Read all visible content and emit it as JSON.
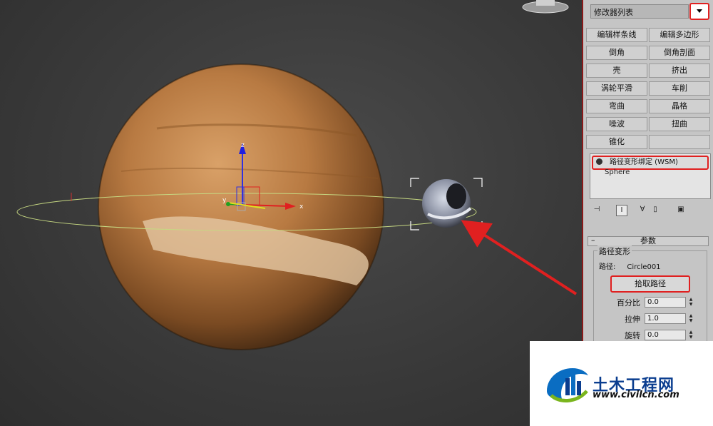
{
  "modifier_panel": {
    "list_label": "修改器列表",
    "buttons": [
      [
        "编辑样条线",
        "编辑多边形"
      ],
      [
        "倒角",
        "倒角剖面"
      ],
      [
        "壳",
        "挤出"
      ],
      [
        "涡轮平滑",
        "车削"
      ],
      [
        "弯曲",
        "晶格"
      ],
      [
        "噪波",
        "扭曲"
      ],
      [
        "锥化",
        ""
      ]
    ],
    "stack": {
      "item_1": "路径变形绑定 (WSM)",
      "item_2": "Sphere"
    }
  },
  "params": {
    "rollout_title": "参数",
    "group_title": "路径变形",
    "path_label": "路径:",
    "path_value": "Circle001",
    "pick_path_button": "拾取路径",
    "percent_label": "百分比",
    "percent_value": "0.0",
    "stretch_label": "拉伸",
    "stretch_value": "1.0",
    "rotation_label": "旋转",
    "rotation_value": "0.0"
  },
  "viewport": {
    "axis_z": "z",
    "axis_x": "x",
    "axis_y": "y"
  },
  "watermark": {
    "title": "土木工程网",
    "url": "www.civilcn.com"
  },
  "colors": {
    "highlight": "#e02020",
    "panel_bg": "#c5c5c5",
    "viewport_bg": "#3a3a3a"
  }
}
